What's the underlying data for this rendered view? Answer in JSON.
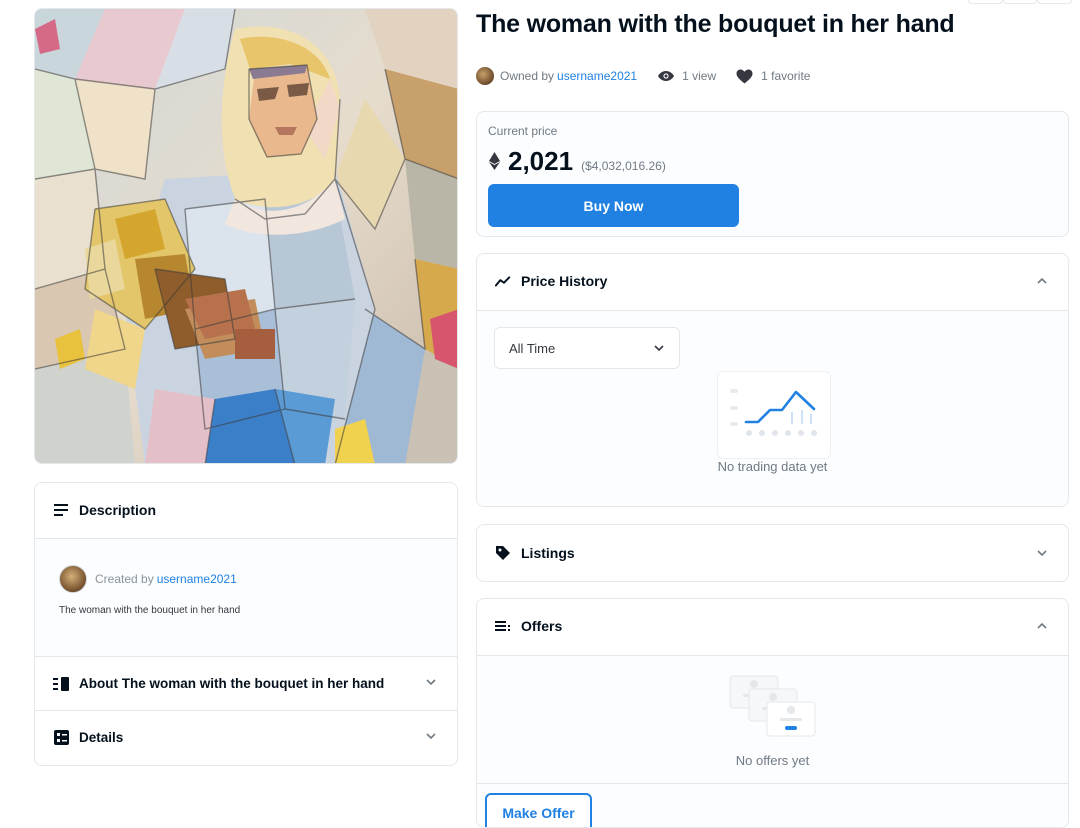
{
  "asset": {
    "title": "The woman with the bouquet in her hand",
    "owner_prefix": "Owned by",
    "owner": "username2021",
    "views": "1 view",
    "favorites": "1 favorite"
  },
  "price": {
    "label": "Current price",
    "currency_icon": "ethereum-icon",
    "value": "2,021",
    "usd": "($4,032,016.26)",
    "buy_label": "Buy Now"
  },
  "price_history": {
    "title": "Price History",
    "range_selected": "All Time",
    "empty_text": "No trading data yet"
  },
  "listings": {
    "title": "Listings"
  },
  "offers": {
    "title": "Offers",
    "empty_text": "No offers yet",
    "make_offer_label": "Make Offer"
  },
  "description": {
    "title": "Description",
    "created_prefix": "Created by",
    "creator": "username2021",
    "text": "The woman with the bouquet in her hand"
  },
  "about": {
    "title": "About The woman with the bouquet in her hand"
  },
  "details": {
    "title": "Details"
  },
  "colors": {
    "accent": "#2081e2",
    "border": "#e5e8eb",
    "text": "#04111d",
    "muted": "#707a83"
  }
}
